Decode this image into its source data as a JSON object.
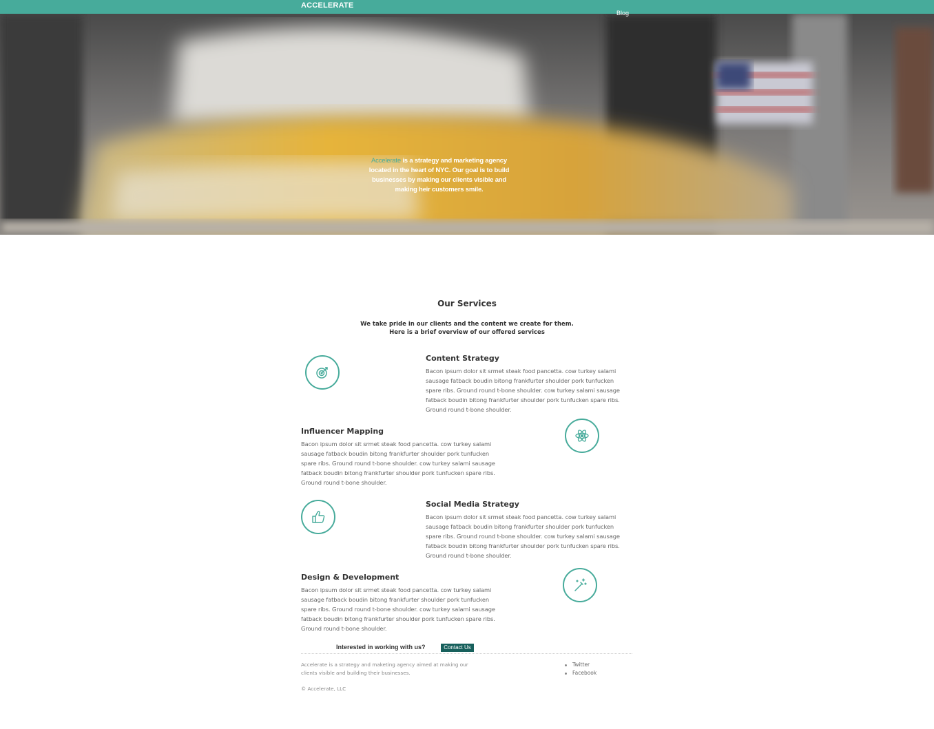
{
  "header": {
    "logo": "ACCELERATE",
    "nav": [
      "Blog"
    ]
  },
  "hero": {
    "brand_word": "Accelerate",
    "tagline": " is a strategy and marketing agency located in the heart of NYC. Our goal is to build businesses by making our clients visible and making heir customers smile."
  },
  "services": {
    "title": "Our Services",
    "subtitle_line1": "We take pride in our clients and the content we create for them.",
    "subtitle_line2": "Here is a brief overview of our offered services",
    "items": [
      {
        "title": "Content Strategy",
        "icon": "target-icon",
        "description": "Bacon ipsum dolor sit srmet steak food pancetta. cow turkey salami sausage fatback boudin bitong frankfurter shoulder pork tunfucken spare ribs. Ground round t-bone shoulder. cow turkey salami sausage fatback boudin bitong frankfurter shoulder pork tunfucken spare ribs. Ground round t-bone shoulder."
      },
      {
        "title": "Influencer Mapping",
        "icon": "atom-icon",
        "description": "Bacon ipsum dolor sit srmet steak food pancetta. cow turkey salami sausage fatback boudin bitong frankfurter shoulder pork tunfucken spare ribs. Ground round t-bone shoulder. cow turkey salami sausage fatback boudin bitong frankfurter shoulder pork tunfucken spare ribs. Ground round t-bone shoulder."
      },
      {
        "title": "Social Media Strategy",
        "icon": "thumbs-up-icon",
        "description": "Bacon ipsum dolor sit srmet steak food pancetta. cow turkey salami sausage fatback boudin bitong frankfurter shoulder pork tunfucken spare ribs. Ground round t-bone shoulder. cow turkey salami sausage fatback boudin bitong frankfurter shoulder pork tunfucken spare ribs. Ground round t-bone shoulder."
      },
      {
        "title": "Design & Development",
        "icon": "magic-wand-icon",
        "description": "Bacon ipsum dolor sit srmet steak food pancetta. cow turkey salami sausage fatback boudin bitong frankfurter shoulder pork tunfucken spare ribs. Ground round t-bone shoulder. cow turkey salami sausage fatback boudin bitong frankfurter shoulder pork tunfucken spare ribs. Ground round t-bone shoulder."
      }
    ]
  },
  "cta": {
    "text": "Interested in working with us?",
    "button": "Contact Us"
  },
  "footer": {
    "about": "Accelerate is a strategy and maketing agency aimed at making our clients visible and building their businesses.",
    "links": [
      "Twitter",
      "Facebook"
    ],
    "copyright": "© Accelerate, LLC"
  },
  "colors": {
    "accent": "#47ab9b",
    "button": "#17605c"
  }
}
